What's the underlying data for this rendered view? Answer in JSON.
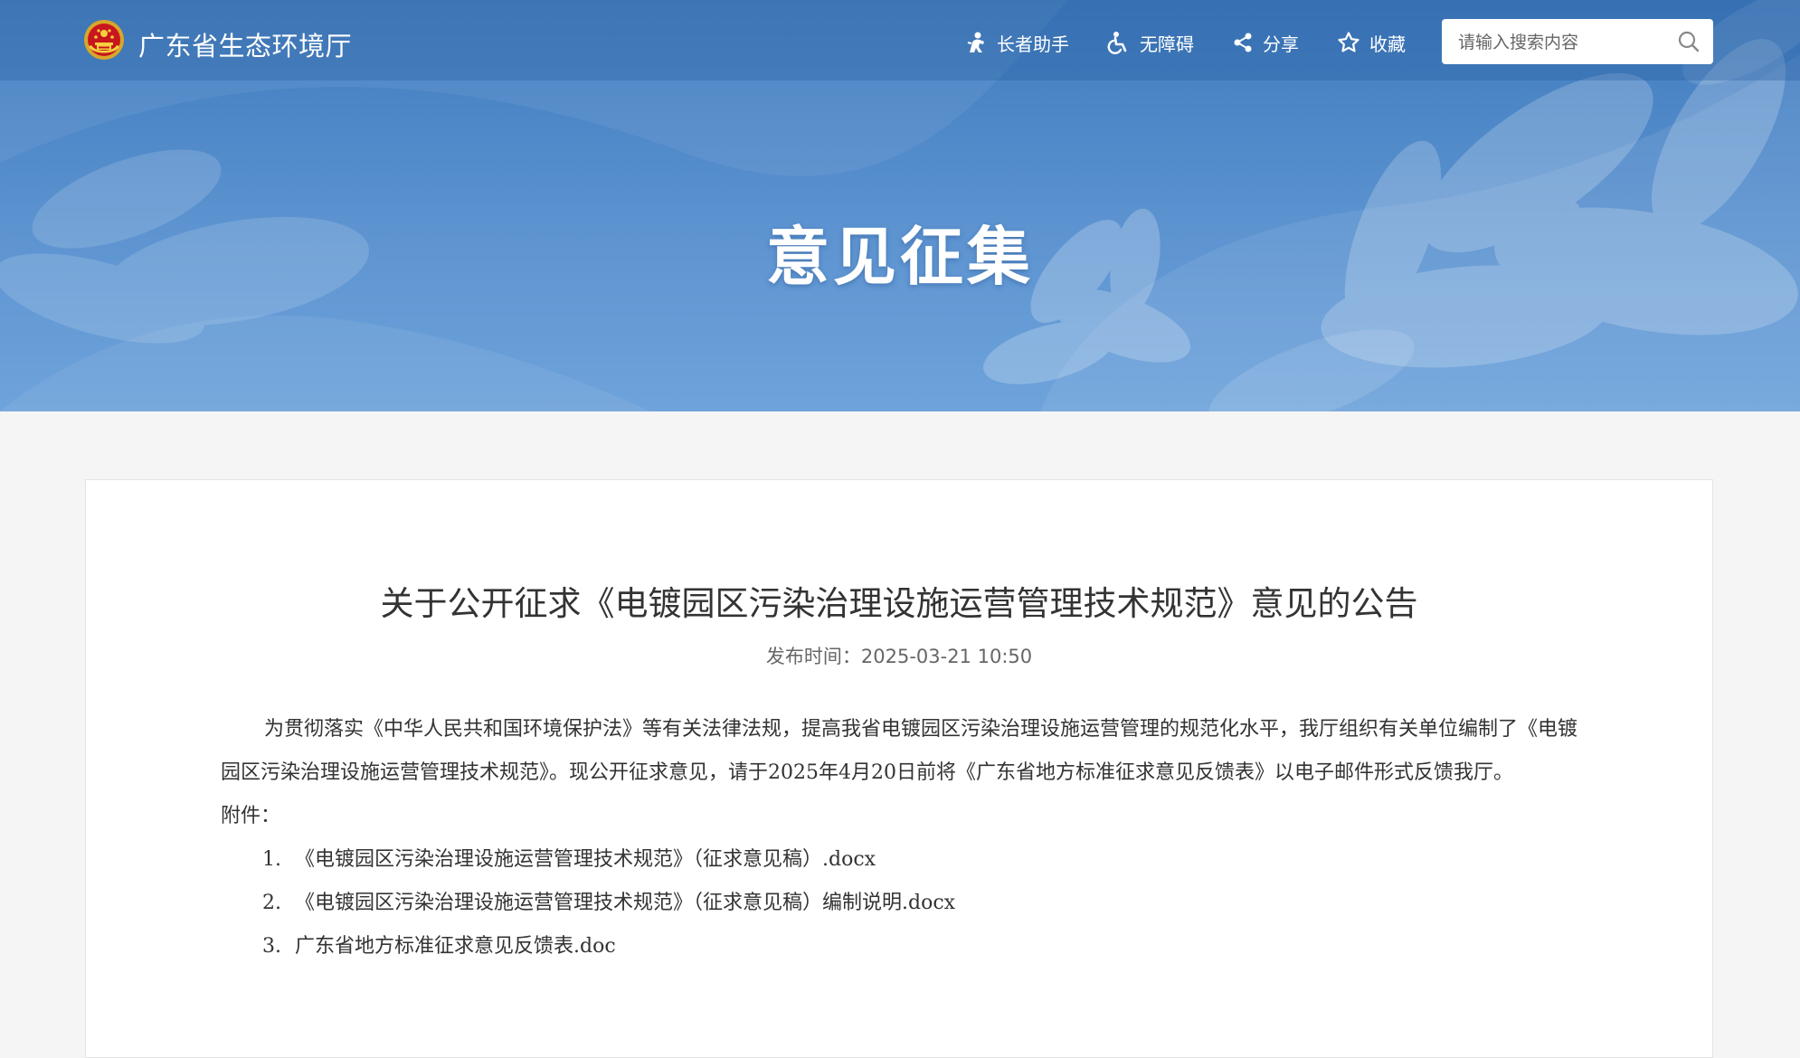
{
  "header": {
    "site_title": "广东省生态环境厅",
    "nav": [
      {
        "label": "长者助手",
        "icon": "elderly-assist-icon"
      },
      {
        "label": "无障碍",
        "icon": "wheelchair-icon"
      },
      {
        "label": "分享",
        "icon": "share-icon"
      },
      {
        "label": "收藏",
        "icon": "star-icon"
      }
    ],
    "search": {
      "placeholder": "请输入搜索内容",
      "value": "",
      "icon": "search-icon"
    }
  },
  "banner": {
    "title": "意见征集"
  },
  "article": {
    "title": "关于公开征求《电镀园区污染治理设施运营管理技术规范》意见的公告",
    "publish_time": "发布时间：2025-03-21 10:50",
    "paragraph": "为贯彻落实《中华人民共和国环境保护法》等有关法律法规，提高我省电镀园区污染治理设施运营管理的规范化水平，我厅组织有关单位编制了《电镀园区污染治理设施运营管理技术规范》。现公开征求意见，请于2025年4月20日前将《广东省地方标准征求意见反馈表》以电子邮件形式反馈我厅。",
    "attachments_label": "附件：",
    "attachments": [
      {
        "num": "1.",
        "name": "《电镀园区污染治理设施运营管理技术规范》（征求意见稿）.docx"
      },
      {
        "num": "2.",
        "name": "《电镀园区污染治理设施运营管理技术规范》（征求意见稿）编制说明.docx"
      },
      {
        "num": "3.",
        "name": "广东省地方标准征求意见反馈表.doc"
      }
    ]
  },
  "colors": {
    "banner_top": "#3f7bbe",
    "banner_bottom": "#6ea3db",
    "page_bg": "#f5f5f5",
    "text": "#333333",
    "muted": "#666666"
  }
}
